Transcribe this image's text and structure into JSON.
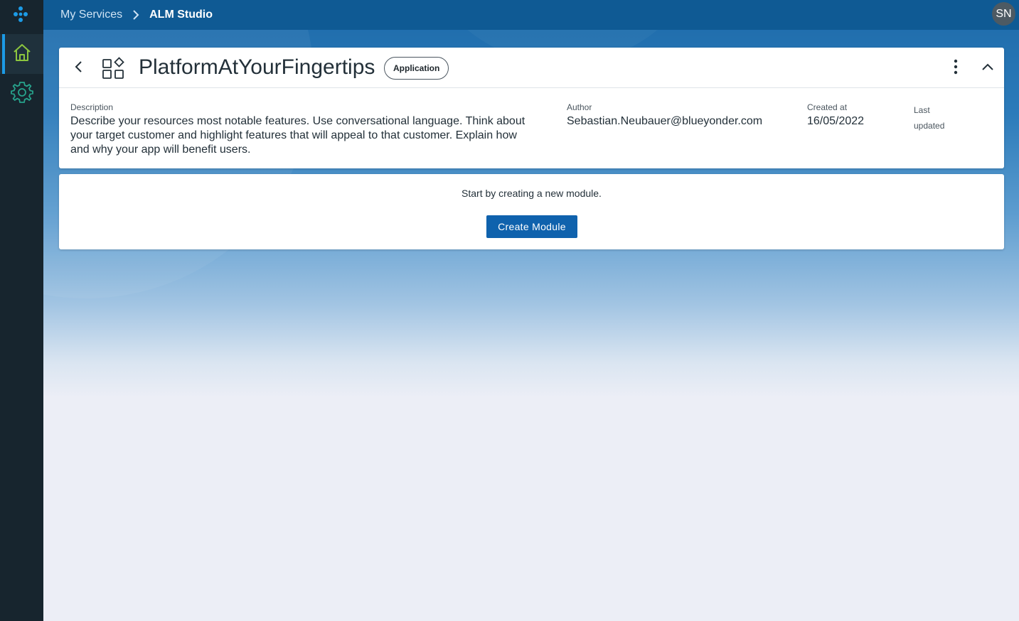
{
  "topbar": {
    "breadcrumb_parent": "My Services",
    "breadcrumb_current": "ALM Studio",
    "avatar_initials": "SN",
    "background": "#0f5a94"
  },
  "sidebar": {
    "items": [
      {
        "name": "home",
        "icon": "home-icon",
        "active": true
      },
      {
        "name": "settings",
        "icon": "gear-icon",
        "active": false
      }
    ],
    "accent": "#1c9be6"
  },
  "application": {
    "title": "PlatformAtYourFingertips",
    "type_badge": "Application",
    "description_label": "Description",
    "description": "Describe your resources most notable features. Use conversational language. Think about your target customer and highlight features that will appeal to that customer. Explain how and why your app will benefit users.",
    "author_label": "Author",
    "author": "Sebastian.Neubauer@blueyonder.com",
    "created_label": "Created at",
    "created": "16/05/2022",
    "updated_label": "Last updated"
  },
  "modules": {
    "empty_text": "Start by creating a new module.",
    "create_label": "Create Module",
    "button_color": "#0f62ad"
  }
}
